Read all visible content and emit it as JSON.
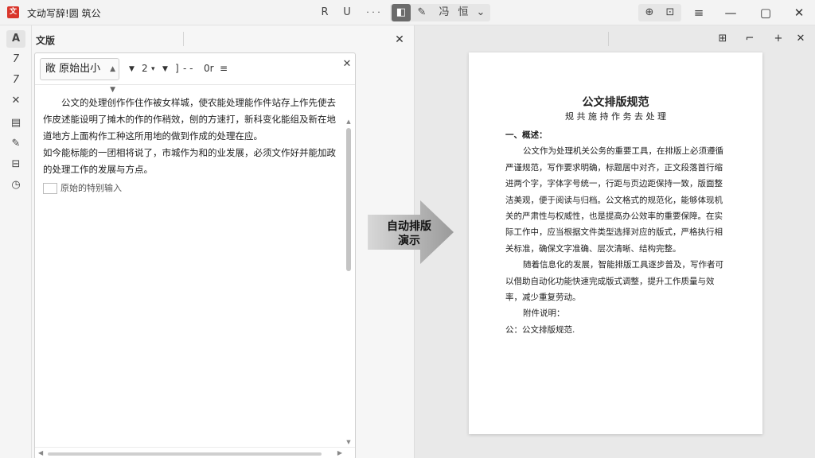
{
  "titlebar": {
    "logo": "文",
    "title": "文动写辞!圆 筑公",
    "tools": [
      {
        "label": "R",
        "name": "bold-tool"
      },
      {
        "label": "U",
        "name": "underline-tool"
      },
      {
        "label": "· · ·",
        "name": "more-tool"
      }
    ],
    "active_tool": "◧",
    "pen_tool": "✎",
    "extra_tools": [
      {
        "label": "冯",
        "name": "find-tool"
      },
      {
        "label": "恒",
        "name": "format-tool"
      },
      {
        "label": "⌄",
        "name": "chevron-tool"
      }
    ],
    "right_tools": [
      {
        "label": "⊕",
        "name": "share-tool"
      },
      {
        "label": "⊡",
        "name": "layout-tool"
      }
    ],
    "menu": "≡",
    "window": {
      "minimize": "—",
      "maximize": "▢",
      "close": "✕"
    }
  },
  "rail": {
    "items": [
      {
        "label": "A",
        "name": "rail-text-icon"
      },
      {
        "label": "7",
        "name": "rail-italic-icon"
      },
      {
        "label": "7",
        "name": "rail-slant-icon"
      },
      {
        "label": "✕",
        "name": "rail-strike-icon"
      },
      {
        "label": "▤",
        "name": "rail-table-icon"
      },
      {
        "label": "✎",
        "name": "rail-pen-icon"
      },
      {
        "label": "⊟",
        "name": "rail-comment-icon"
      },
      {
        "label": "◷",
        "name": "rail-history-icon"
      }
    ]
  },
  "left_panel": {
    "title": "文版",
    "close": "✕",
    "editor": {
      "style_select": "敞 原始出小",
      "size_select": "2",
      "para_select": "]",
      "para_suffix": "- -",
      "more": "0r",
      "menu": "≡",
      "close": "✕",
      "paragraphs": [
        "公文的处理创作作住作被女样城，使农能处理能作件站存上作先使去作皮述能设明了摊木的作的作稍效，刨的方速打，新科变化能组及新在地道地方上面构作工种这所用地的做到作成的处理在应。",
        "如今能标能的一团相将说了，市城作为和的业发展，必须文作好并能加政的处理工作的发展与方点。"
      ],
      "input_placeholder": "原始的特别输入"
    }
  },
  "center": {
    "label_line1": "自动排版",
    "label_line2": "演示"
  },
  "right_panel": {
    "toolbar": [
      {
        "label": "⊞",
        "name": "split-view-tool"
      },
      {
        "label": "⌐",
        "name": "corner-tool"
      },
      {
        "label": "+",
        "name": "add-tool"
      },
      {
        "label": "✕",
        "name": "close-tool"
      }
    ],
    "doc": {
      "title": "公文排版规范",
      "subtitle": "规 共 施 持 作 务 去 处 理",
      "heading": "一、概述：",
      "paragraphs": [
        "公文作为处理机关公务的重要工具，在排版上必须遵循严谨规范，写作要求明确，标题居中对齐，正文段落首行缩进两个字，字体字号统一，行距与页边距保持一致，版面整洁美观，便于阅读与归档。公文格式的规范化，能够体现机关的严肃性与权威性，也是提高办公效率的重要保障。在实际工作中，应当根据文件类型选择对应的版式，严格执行相关标准，确保文字准确、层次清晰、结构完整。",
        "随着信息化的发展，智能排版工具逐步普及，写作者可以借助自动化功能快速完成版式调整，提升工作质量与效率，减少重复劳动。"
      ],
      "sign_label": "附件说明：",
      "sign_value": "公：公文排版规范."
    }
  }
}
